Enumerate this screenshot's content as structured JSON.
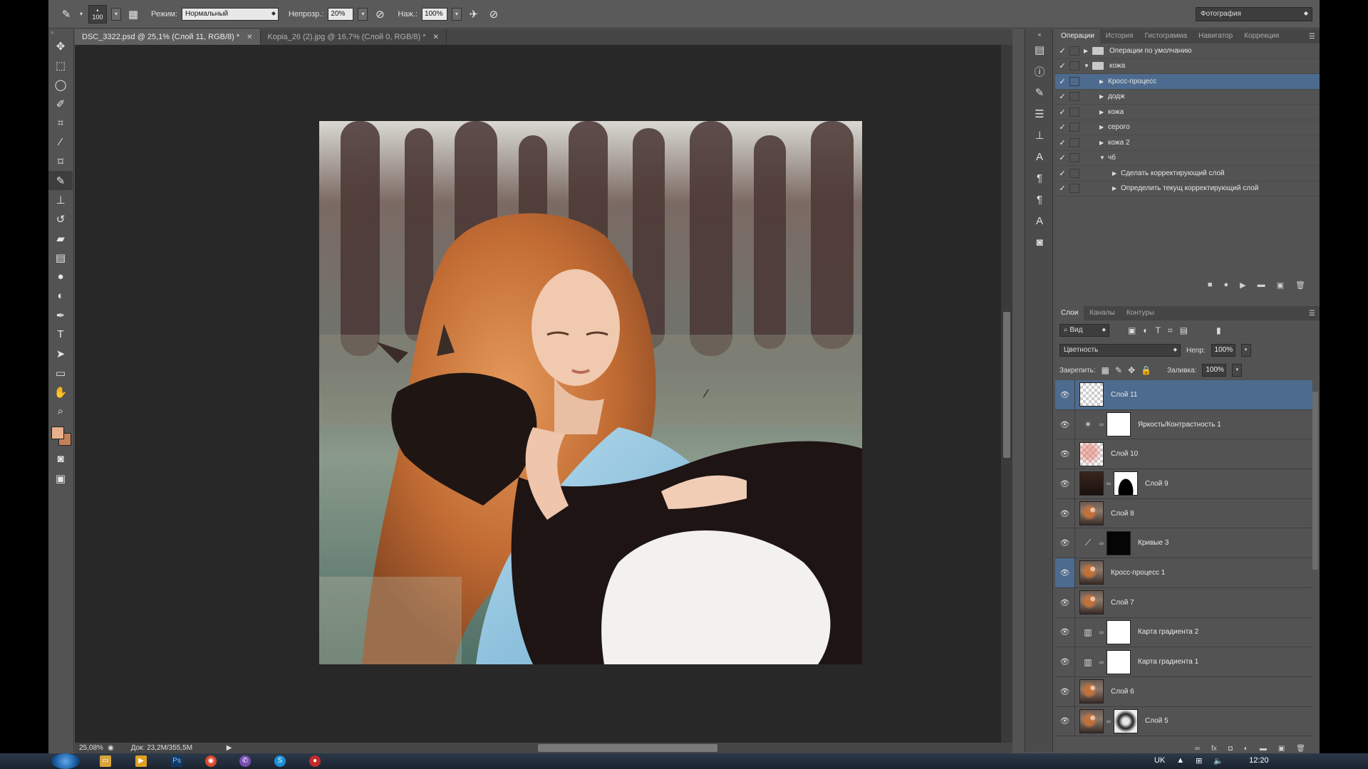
{
  "options_bar": {
    "brush_size": "100",
    "mode_label": "Режим:",
    "mode_value": "Нормальный",
    "opacity_label": "Непрозр.:",
    "opacity_value": "20%",
    "flow_label": "Наж.:",
    "flow_value": "100%",
    "workspace": "Фотография"
  },
  "document_tabs": [
    {
      "label": "DSC_3322.psd @ 25,1% (Слой 11, RGB/8) *",
      "active": true
    },
    {
      "label": "Kopia_26 (2).jpg @ 16,7% (Слой 0, RGB/8) *",
      "active": false
    }
  ],
  "status_bar": {
    "zoom": "25,08%",
    "doc_size": "Док: 23,2M/355,5M"
  },
  "actions_panel": {
    "tabs": [
      "Операции",
      "История",
      "Гистограмма",
      "Навигатор",
      "Коррекция"
    ],
    "rows": [
      {
        "label": "Операции по умолчанию",
        "indent": 0,
        "type": "set",
        "expanded": false
      },
      {
        "label": "кожа",
        "indent": 0,
        "type": "set",
        "expanded": true
      },
      {
        "label": "Кросс-процесс",
        "indent": 1,
        "type": "action",
        "expanded": false,
        "selected": true
      },
      {
        "label": "додж",
        "indent": 1,
        "type": "action",
        "expanded": false
      },
      {
        "label": "кожа",
        "indent": 1,
        "type": "action",
        "expanded": false
      },
      {
        "label": "серого",
        "indent": 1,
        "type": "action",
        "expanded": false
      },
      {
        "label": "кожа 2",
        "indent": 1,
        "type": "action",
        "expanded": false
      },
      {
        "label": "чб",
        "indent": 1,
        "type": "action",
        "expanded": true
      },
      {
        "label": "Сделать корректирующий слой",
        "indent": 2,
        "type": "step",
        "expanded": false
      },
      {
        "label": "Определить текущ корректирующий слой",
        "indent": 2,
        "type": "step",
        "expanded": false
      }
    ]
  },
  "layers_panel": {
    "tabs": [
      "Слои",
      "Каналы",
      "Контуры"
    ],
    "filter_label": "Вид",
    "blend_mode": "Цветность",
    "opacity_label": "Непр:",
    "opacity_value": "100%",
    "lock_label": "Закрепить:",
    "fill_label": "Заливка:",
    "fill_value": "100%",
    "layers": [
      {
        "name": "Слой 11",
        "thumb": "checker",
        "mask": "",
        "selected": true
      },
      {
        "name": "Яркость/Контрастность 1",
        "thumb": "adj-sun",
        "mask": "white"
      },
      {
        "name": "Слой 10",
        "thumb": "checker-red",
        "mask": ""
      },
      {
        "name": "Слой 9",
        "thumb": "dark",
        "mask": "curve"
      },
      {
        "name": "Слой 8",
        "thumb": "photo",
        "mask": ""
      },
      {
        "name": "Кривые 3",
        "thumb": "adj-curve",
        "mask": "black"
      },
      {
        "name": "Кросс-процесс 1",
        "thumb": "photo",
        "mask": "",
        "eye_selected": true
      },
      {
        "name": "Слой 7",
        "thumb": "photo",
        "mask": ""
      },
      {
        "name": "Карта градиента 2",
        "thumb": "adj-grad",
        "mask": "white"
      },
      {
        "name": "Карта градиента 1",
        "thumb": "adj-grad",
        "mask": "white"
      },
      {
        "name": "Слой 6",
        "thumb": "photo",
        "mask": ""
      },
      {
        "name": "Слой 5",
        "thumb": "photo",
        "mask": "head"
      }
    ]
  },
  "taskbar": {
    "lang": "UK",
    "time": "12:20"
  }
}
